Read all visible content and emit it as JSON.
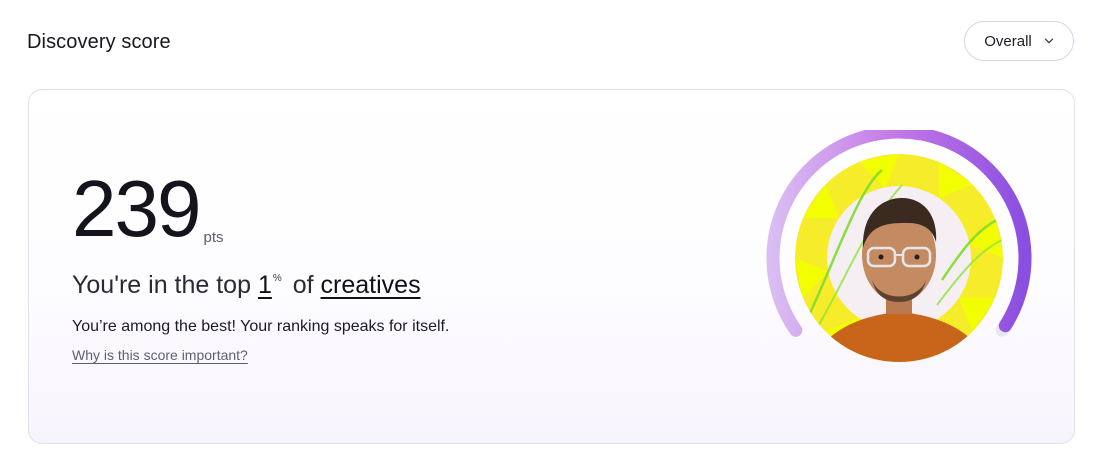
{
  "header": {
    "title": "Discovery score"
  },
  "filter": {
    "selected": "Overall"
  },
  "score": {
    "value": "239",
    "unit": "pts",
    "rank_prefix": "You're in the top",
    "rank_value": "1",
    "rank_unit": "%",
    "rank_middle": "of",
    "rank_group": "creatives",
    "description": "You’re among the best! Your ranking speaks for itself.",
    "link": "Why is this score important?"
  },
  "gauge": {
    "level": 0.99,
    "colors": {
      "track": "#e9e6f0",
      "arc_start": "#d7b6f2",
      "arc_mid": "#b664dc",
      "arc_end": "#8b4fe0"
    }
  },
  "avatar": {
    "icon": "profile-photo",
    "colors": {
      "background": "#f7ec2a",
      "ray": "#f2ff00",
      "shirt": "#c8651a",
      "skin": "#c48a62",
      "hair": "#3a2a1f"
    }
  },
  "colors": {
    "accent": "#9c55e3",
    "border": "#e2e0ea"
  }
}
